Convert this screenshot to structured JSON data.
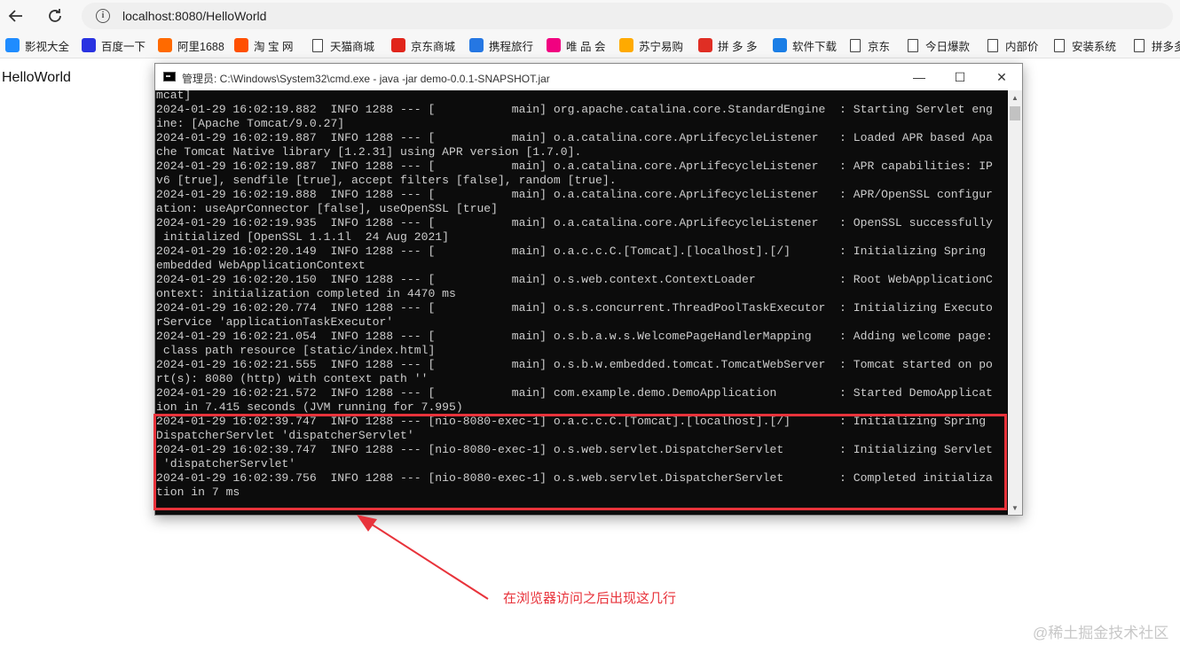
{
  "browser": {
    "url": "localhost:8080/HelloWorld",
    "bookmarks": [
      {
        "label": "影视大全",
        "icon": "video-app-icon",
        "color": "#1f8cff"
      },
      {
        "label": "百度一下",
        "icon": "baidu-paw-icon",
        "color": "#2932e1"
      },
      {
        "label": "阿里1688",
        "icon": "1688-icon",
        "color": "#ff6a00"
      },
      {
        "label": "淘 宝 网",
        "icon": "taobao-icon",
        "color": "#ff5000"
      },
      {
        "label": "天猫商城",
        "icon": "document-icon",
        "color": ""
      },
      {
        "label": "京东商城",
        "icon": "jd-icon",
        "color": "#e1251b"
      },
      {
        "label": "携程旅行",
        "icon": "ctrip-icon",
        "color": "#2577e3"
      },
      {
        "label": "唯 品 会",
        "icon": "vip-icon",
        "color": "#f10180"
      },
      {
        "label": "苏宁易购",
        "icon": "suning-icon",
        "color": "#ffaa00"
      },
      {
        "label": "拼 多 多",
        "icon": "pinduoduo-icon",
        "color": "#e02e24"
      },
      {
        "label": "软件下载",
        "icon": "software-icon",
        "color": "#1a7ee6"
      },
      {
        "label": "京东",
        "icon": "document-icon",
        "color": ""
      },
      {
        "label": "今日爆款",
        "icon": "document-icon",
        "color": ""
      },
      {
        "label": "内部价",
        "icon": "document-icon",
        "color": ""
      },
      {
        "label": "安装系统",
        "icon": "document-icon",
        "color": ""
      },
      {
        "label": "拼多多",
        "icon": "document-icon",
        "color": ""
      }
    ]
  },
  "page": {
    "text": "HelloWorld"
  },
  "cmd": {
    "title": "管理员: C:\\Windows\\System32\\cmd.exe - java  -jar demo-0.0.1-SNAPSHOT.jar",
    "minimize": "—",
    "maximize": "☐",
    "close": "✕",
    "lines": [
      "mcat]",
      "2024-01-29 16:02:19.882  INFO 1288 --- [           main] org.apache.catalina.core.StandardEngine  : Starting Servlet eng",
      "ine: [Apache Tomcat/9.0.27]",
      "2024-01-29 16:02:19.887  INFO 1288 --- [           main] o.a.catalina.core.AprLifecycleListener   : Loaded APR based Apa",
      "che Tomcat Native library [1.2.31] using APR version [1.7.0].",
      "2024-01-29 16:02:19.887  INFO 1288 --- [           main] o.a.catalina.core.AprLifecycleListener   : APR capabilities: IP",
      "v6 [true], sendfile [true], accept filters [false], random [true].",
      "2024-01-29 16:02:19.888  INFO 1288 --- [           main] o.a.catalina.core.AprLifecycleListener   : APR/OpenSSL configur",
      "ation: useAprConnector [false], useOpenSSL [true]",
      "2024-01-29 16:02:19.935  INFO 1288 --- [           main] o.a.catalina.core.AprLifecycleListener   : OpenSSL successfully",
      " initialized [OpenSSL 1.1.1l  24 Aug 2021]",
      "2024-01-29 16:02:20.149  INFO 1288 --- [           main] o.a.c.c.C.[Tomcat].[localhost].[/]       : Initializing Spring",
      "embedded WebApplicationContext",
      "2024-01-29 16:02:20.150  INFO 1288 --- [           main] o.s.web.context.ContextLoader            : Root WebApplicationC",
      "ontext: initialization completed in 4470 ms",
      "2024-01-29 16:02:20.774  INFO 1288 --- [           main] o.s.s.concurrent.ThreadPoolTaskExecutor  : Initializing Executo",
      "rService 'applicationTaskExecutor'",
      "2024-01-29 16:02:21.054  INFO 1288 --- [           main] o.s.b.a.w.s.WelcomePageHandlerMapping    : Adding welcome page:",
      " class path resource [static/index.html]",
      "2024-01-29 16:02:21.555  INFO 1288 --- [           main] o.s.b.w.embedded.tomcat.TomcatWebServer  : Tomcat started on po",
      "rt(s): 8080 (http) with context path ''",
      "2024-01-29 16:02:21.572  INFO 1288 --- [           main] com.example.demo.DemoApplication         : Started DemoApplicat",
      "ion in 7.415 seconds (JVM running for 7.995)",
      "2024-01-29 16:02:39.747  INFO 1288 --- [nio-8080-exec-1] o.a.c.c.C.[Tomcat].[localhost].[/]       : Initializing Spring",
      "DispatcherServlet 'dispatcherServlet'",
      "2024-01-29 16:02:39.747  INFO 1288 --- [nio-8080-exec-1] o.s.web.servlet.DispatcherServlet        : Initializing Servlet",
      " 'dispatcherServlet'",
      "2024-01-29 16:02:39.756  INFO 1288 --- [nio-8080-exec-1] o.s.web.servlet.DispatcherServlet        : Completed initializa",
      "tion in 7 ms"
    ]
  },
  "annotation": {
    "text": "在浏览器访问之后出现这几行",
    "color": "#e8333b"
  },
  "watermark": "@稀土掘金技术社区"
}
